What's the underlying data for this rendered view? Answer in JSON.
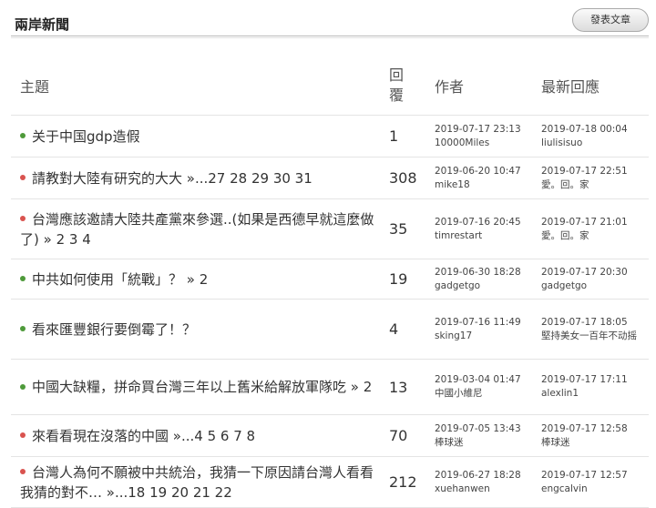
{
  "board": {
    "title": "兩岸新聞",
    "post_button_label": "發表文章"
  },
  "columns": {
    "subject": "主題",
    "replies_line1": "回",
    "replies_line2": "覆",
    "author": "作者",
    "latest": "最新回應"
  },
  "threads": [
    {
      "status_color": "green",
      "title": "关于中国gdp造假",
      "pages": "",
      "replies": "1",
      "author_time": "2019-07-17 23:13",
      "author": "10000Miles",
      "latest_time": "2019-07-18 00:04",
      "latest_user": "liulisisuo"
    },
    {
      "status_color": "red",
      "title": "請教對大陸有研究的大大",
      "pages": " »...27 28 29 30 31",
      "replies": "308",
      "author_time": "2019-06-20 10:47",
      "author": "mike18",
      "latest_time": "2019-07-17 22:51",
      "latest_user": "愛。回。家"
    },
    {
      "status_color": "red",
      "title": "台灣應該邀請大陸共產黨來參選..(如果是西德早就這麼做了)",
      "pages": " » 2 3 4",
      "replies": "35",
      "author_time": "2019-07-16 20:45",
      "author": "timrestart",
      "latest_time": "2019-07-17 21:01",
      "latest_user": "愛。回。家"
    },
    {
      "status_color": "green",
      "title": "中共如何使用「統戰」？",
      "pages": " » 2",
      "replies": "19",
      "author_time": "2019-06-30 18:28",
      "author": "gadgetgo",
      "latest_time": "2019-07-17 20:30",
      "latest_user": "gadgetgo"
    },
    {
      "status_color": "green",
      "title": "看來匯豐銀行要倒霉了！？",
      "pages": "",
      "replies": "4",
      "author_time": "2019-07-16 11:49",
      "author": "sking17",
      "latest_time": "2019-07-17 18:05",
      "latest_user": "堅持美女一百年不动摇"
    },
    {
      "status_color": "green",
      "title": "中國大缺糧，拼命買台灣三年以上舊米給解放軍隊吃",
      "pages": " » 2",
      "replies": "13",
      "author_time": "2019-03-04 01:47",
      "author": "中國小維尼",
      "latest_time": "2019-07-17 17:11",
      "latest_user": "alexlin1"
    },
    {
      "status_color": "red",
      "title": "來看看現在沒落的中國",
      "pages": " »...4 5 6 7 8",
      "replies": "70",
      "author_time": "2019-07-05 13:43",
      "author": "棒球迷",
      "latest_time": "2019-07-17 12:58",
      "latest_user": "棒球迷"
    },
    {
      "status_color": "red",
      "title": "台灣人為何不願被中共統治，我猜一下原因請台灣人看看我猜的對不…",
      "pages": " »...18 19 20 21 22",
      "replies": "212",
      "author_time": "2019-06-27 18:28",
      "author": "xuehanwen",
      "latest_time": "2019-07-17 12:57",
      "latest_user": "engcalvin"
    }
  ],
  "colors": {
    "dot_green": "#4e9a3a",
    "dot_red": "#d9534f",
    "rule": "#bbbbbb"
  }
}
